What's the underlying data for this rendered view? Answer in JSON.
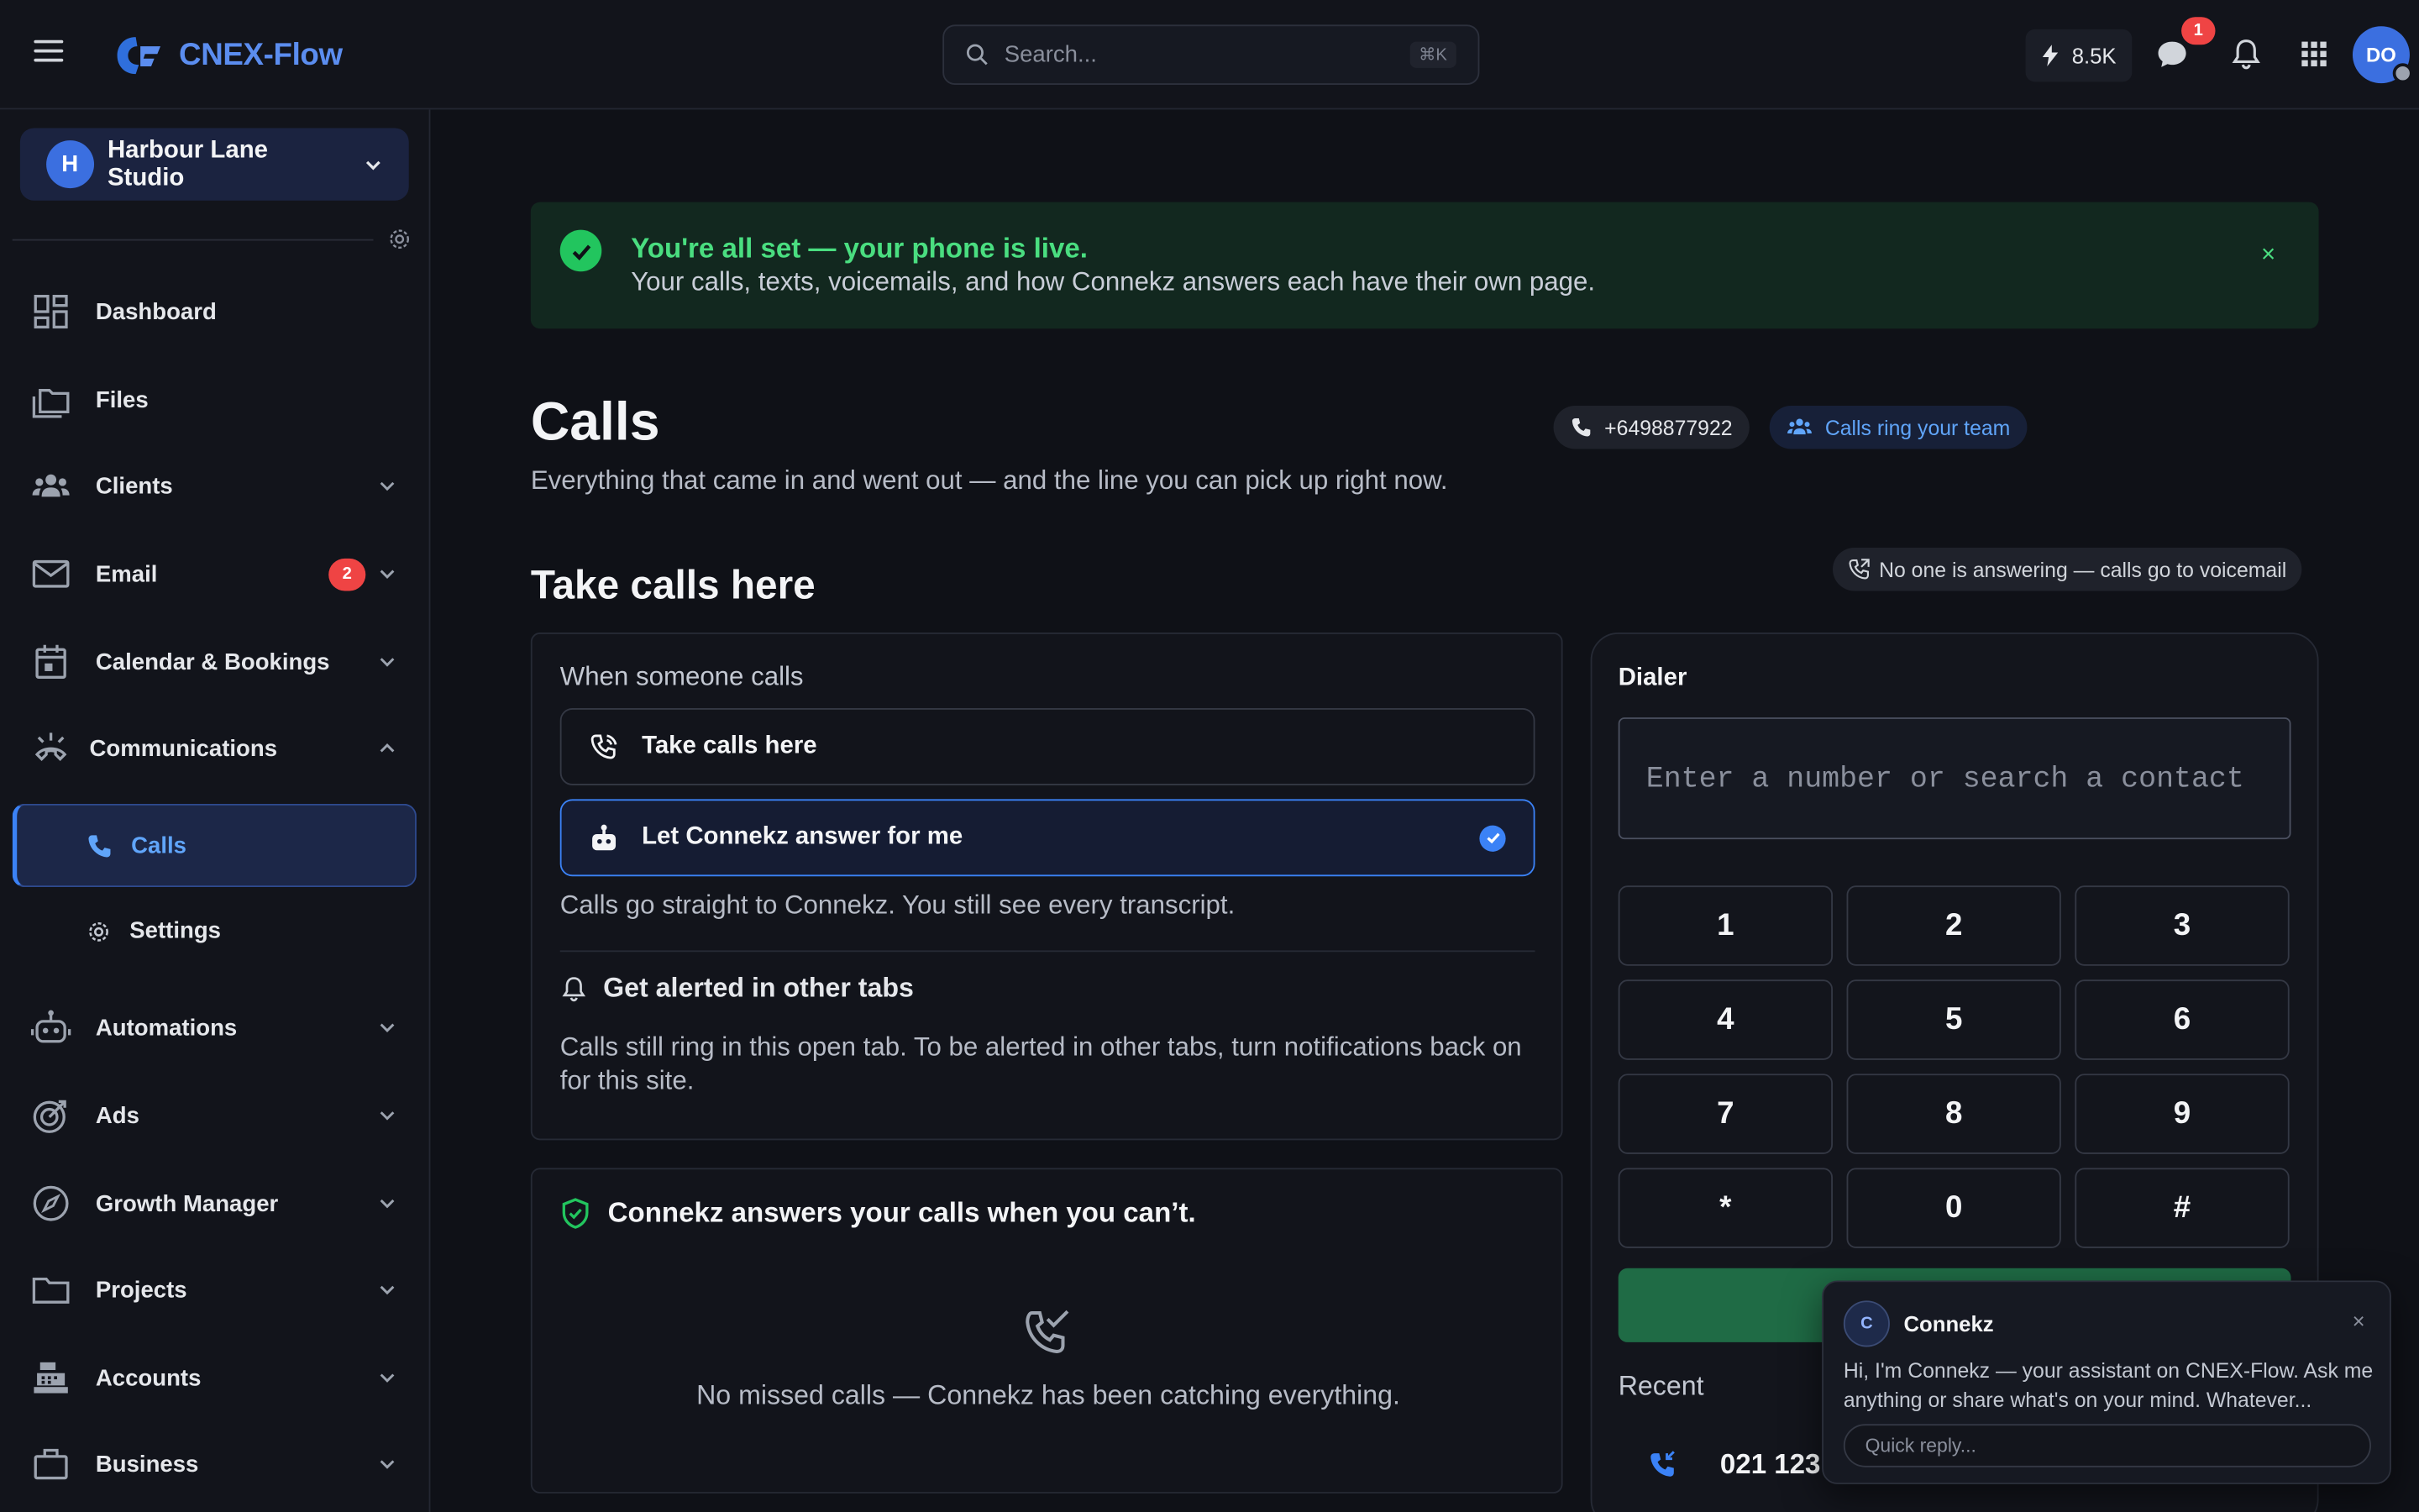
{
  "header": {
    "app_name": "CNEX-Flow",
    "search_placeholder": "Search...",
    "search_shortcut": "⌘K",
    "credits": "8.5K",
    "messages_badge": "1",
    "avatar_initials": "DO"
  },
  "sidebar": {
    "workspace_initial": "H",
    "workspace_name": "Harbour Lane Studio",
    "items": [
      {
        "label": "Dashboard"
      },
      {
        "label": "Files"
      },
      {
        "label": "Clients"
      },
      {
        "label": "Email",
        "badge": "2"
      },
      {
        "label": "Calendar & Bookings"
      },
      {
        "label": "Communications"
      },
      {
        "label": "Automations"
      },
      {
        "label": "Ads"
      },
      {
        "label": "Growth Manager"
      },
      {
        "label": "Projects"
      },
      {
        "label": "Accounts"
      },
      {
        "label": "Business"
      }
    ],
    "sub_calls": "Calls",
    "sub_settings": "Settings"
  },
  "banner": {
    "title": "You're all set — your phone is live.",
    "text": "Your calls, texts, voicemails, and how Connekz answers each have their own page.",
    "close": "×"
  },
  "page": {
    "title": "Calls",
    "subtitle": "Everything that came in and went out — and the line you can pick up right now.",
    "phone_number": "+6498877922",
    "ring_chip": "Calls ring your team",
    "section_title": "Take calls here",
    "status_chip": "No one is answering — calls go to voicemail"
  },
  "answer_card": {
    "heading": "When someone calls",
    "option_1": "Take calls here",
    "option_2": "Let Connekz answer for me",
    "description": "Calls go straight to Connekz. You still see every transcript.",
    "alert_title": "Get alerted in other tabs",
    "alert_text": "Calls still ring in this open tab. To be alerted in other tabs, turn notifications back on for this site."
  },
  "missed_card": {
    "heading": "Connekz answers your calls when you can’t.",
    "empty_text": "No missed calls — Connekz has been catching everything."
  },
  "dialer": {
    "title": "Dialer",
    "input_placeholder": "Enter a number or search a contact",
    "keys": [
      "1",
      "2",
      "3",
      "4",
      "5",
      "6",
      "7",
      "8",
      "9",
      "*",
      "0",
      "#"
    ],
    "recent_label": "Recent",
    "recent_number": "021 123"
  },
  "chat": {
    "avatar": "C",
    "name": "Connekz",
    "close": "×",
    "message": "Hi, I'm Connekz — your assistant on CNEX-Flow. Ask me anything or share what's on your mind. Whatever...",
    "input_placeholder": "Quick reply..."
  },
  "colors": {
    "accent": "#3b82f6",
    "success": "#22c55e",
    "danger": "#ef4444",
    "background": "#0f1117"
  }
}
